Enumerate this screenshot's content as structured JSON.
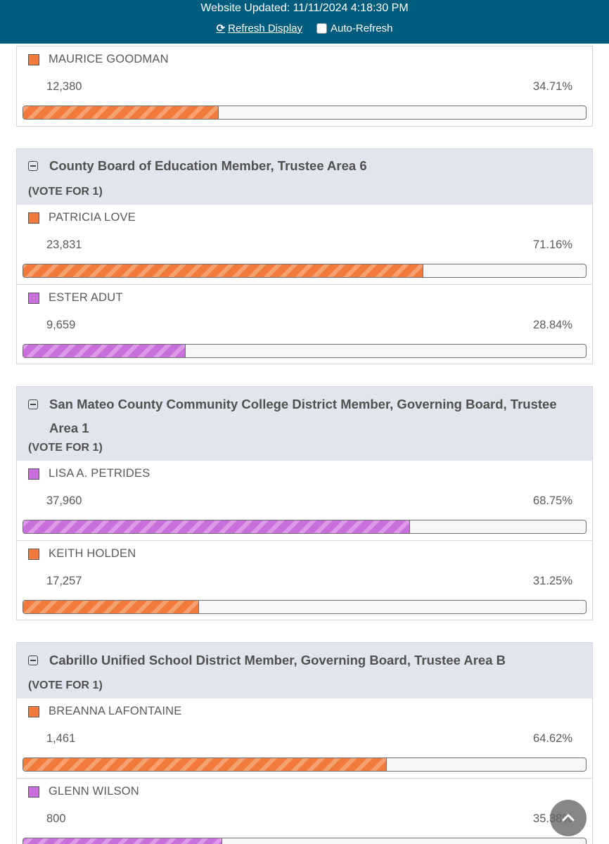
{
  "header": {
    "updated": "Website Updated: 11/11/2024 4:18:30 PM",
    "refresh_label": "Refresh Display",
    "auto_refresh_label": "Auto-Refresh"
  },
  "contests": [
    {
      "title": "",
      "vote_for": "",
      "candidates": [
        {
          "name": "MAURICE GOODMAN",
          "votes": "12,380",
          "pct": "34.71%",
          "share": 34.71,
          "color": "#f27b3b"
        }
      ]
    },
    {
      "title": "County Board of Education Member, Trustee Area 6",
      "vote_for": "(VOTE FOR 1)",
      "candidates": [
        {
          "name": "PATRICIA LOVE",
          "votes": "23,831",
          "pct": "71.16%",
          "share": 71.16,
          "color": "#f27b3b"
        },
        {
          "name": "ESTER ADUT",
          "votes": "9,659",
          "pct": "28.84%",
          "share": 28.84,
          "color": "#c86fdc"
        }
      ]
    },
    {
      "title": "San Mateo County Community College District Member, Governing Board, Trustee Area 1",
      "vote_for": "(VOTE FOR 1)",
      "candidates": [
        {
          "name": "LISA A. PETRIDES",
          "votes": "37,960",
          "pct": "68.75%",
          "share": 68.75,
          "color": "#c86fdc"
        },
        {
          "name": "KEITH HOLDEN",
          "votes": "17,257",
          "pct": "31.25%",
          "share": 31.25,
          "color": "#f27b3b"
        }
      ]
    },
    {
      "title": "Cabrillo Unified School District Member, Governing Board, Trustee Area B",
      "vote_for": "(VOTE FOR 1)",
      "candidates": [
        {
          "name": "BREANNA LAFONTAINE",
          "votes": "1,461",
          "pct": "64.62%",
          "share": 64.62,
          "color": "#f27b3b"
        },
        {
          "name": "GLENN WILSON",
          "votes": "800",
          "pct": "35.38%",
          "share": 35.38,
          "color": "#c86fdc"
        }
      ]
    }
  ],
  "icons": {
    "refresh": "refresh-icon",
    "collapse": "minus-square-icon",
    "scroll_top": "chevron-up-icon"
  }
}
